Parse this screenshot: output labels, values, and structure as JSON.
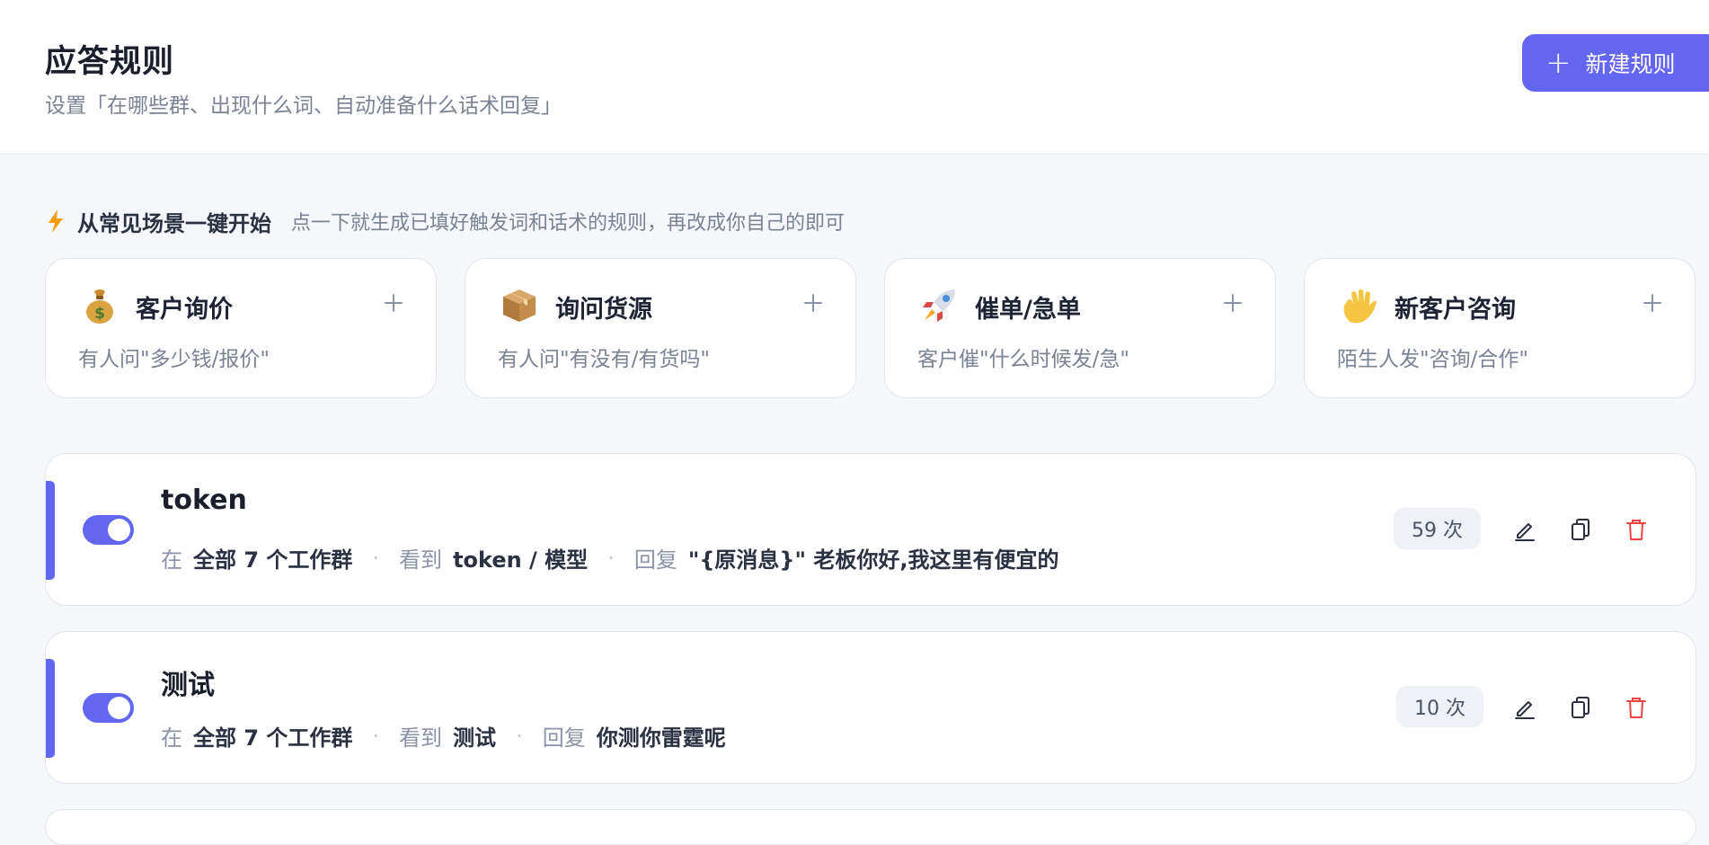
{
  "header": {
    "title": "应答规则",
    "subtitle": "设置「在哪些群、出现什么词、自动准备什么话术回复」",
    "new_button_label": "新建规则"
  },
  "quick_start": {
    "icon": "bolt-icon",
    "title": "从常见场景一键开始",
    "description": "点一下就生成已填好触发词和话术的规则，再改成你自己的即可",
    "templates": [
      {
        "icon": "money-bag-icon",
        "title": "客户询价",
        "description": "有人问\"多少钱/报价\""
      },
      {
        "icon": "package-icon",
        "title": "询问货源",
        "description": "有人问\"有没有/有货吗\""
      },
      {
        "icon": "rocket-icon",
        "title": "催单/急单",
        "description": "客户催\"什么时候发/急\""
      },
      {
        "icon": "waving-hand-icon",
        "title": "新客户咨询",
        "description": "陌生人发\"咨询/合作\""
      }
    ]
  },
  "rules": [
    {
      "name": "token",
      "enabled": true,
      "scope_label": "在",
      "scope_value": "全部 7 个工作群",
      "trigger_label": "看到",
      "trigger_value": "token / 模型",
      "reply_label": "回复",
      "reply_value": "\"{原消息}\" 老板你好,我这里有便宜的",
      "count": "59 次"
    },
    {
      "name": "测试",
      "enabled": true,
      "scope_label": "在",
      "scope_value": "全部 7 个工作群",
      "trigger_label": "看到",
      "trigger_value": "测试",
      "reply_label": "回复",
      "reply_value": "你测你雷霆呢",
      "count": "10 次"
    }
  ],
  "colors": {
    "accent": "#6366f1",
    "danger": "#ef4444",
    "bolt": "#f59e0b",
    "page_bg": "#f5f7fb"
  }
}
